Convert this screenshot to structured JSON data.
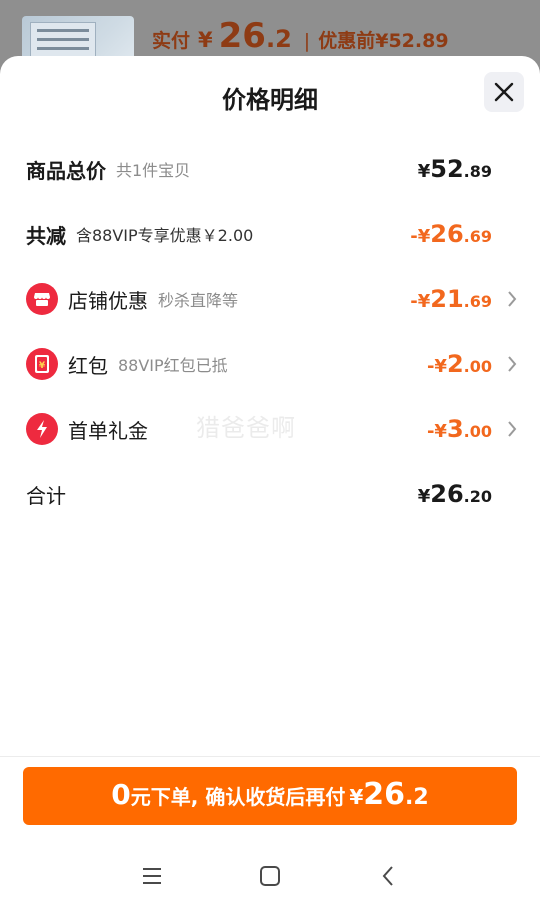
{
  "background": {
    "price_label": "实付",
    "currency": "¥",
    "price_int": "26",
    "price_dec": ".2",
    "separator": "|",
    "original_label": "优惠前",
    "original_price": "¥52.89"
  },
  "sheet": {
    "title": "价格明细",
    "close_icon": "close-icon"
  },
  "rows": {
    "total": {
      "name": "商品总价",
      "sub": "共1件宝贝",
      "cur": "¥",
      "int": "52",
      "dec": ".89"
    },
    "reduce": {
      "name": "共减",
      "sub": "含88VIP专享优惠￥2.00",
      "cur": "-¥",
      "int": "26",
      "dec": ".69"
    },
    "shop": {
      "name": "店铺优惠",
      "sub": "秒杀直降等",
      "cur": "-¥",
      "int": "21",
      "dec": ".69",
      "icon": "shop-icon"
    },
    "redpacket": {
      "name": "红包",
      "sub": "88VIP红包已抵",
      "cur": "-¥",
      "int": "2",
      "dec": ".00",
      "icon": "red-packet-icon"
    },
    "firstorder": {
      "name": "首单礼金",
      "sub": "",
      "cur": "-¥",
      "int": "3",
      "dec": ".00",
      "icon": "lightning-icon"
    },
    "sum": {
      "name": "合计",
      "cur": "¥",
      "int": "26",
      "dec": ".20"
    }
  },
  "watermark": "猎爸爸啊",
  "pay_button": {
    "zero": "0",
    "text": "元下单, 确认收货后再付",
    "cur": "¥",
    "int": "26",
    "dec": ".2"
  },
  "colors": {
    "accent": "#ff6a00",
    "discount": "#f2681e",
    "icon_red": "#ee2a3f"
  },
  "nav": [
    "menu-icon",
    "home-icon",
    "back-icon"
  ]
}
